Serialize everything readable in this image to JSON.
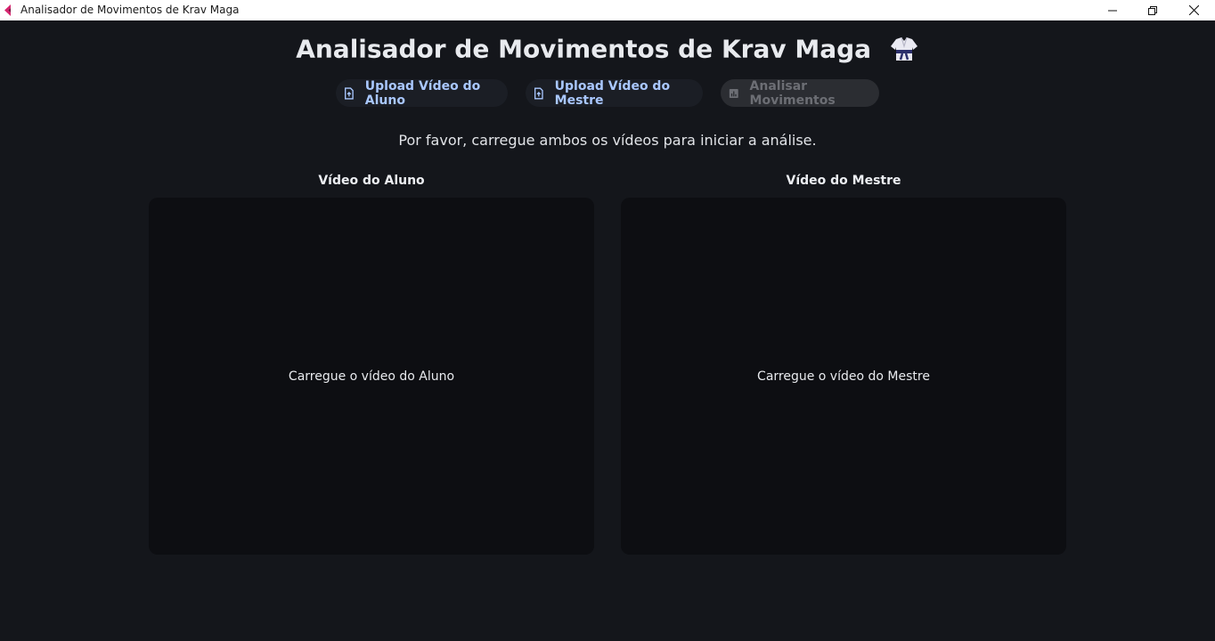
{
  "window": {
    "title": "Analisador de Movimentos de Krav Maga",
    "app_icon": "krav-maga-app-icon",
    "controls": [
      "minimize-icon",
      "restore-icon",
      "close-icon"
    ]
  },
  "header": {
    "title": "Analisador de Movimentos de Krav Maga",
    "title_icon": "martial-arts-uniform-icon"
  },
  "toolbar": {
    "upload_aluno_label": "Upload Vídeo do Aluno",
    "upload_aluno_icon": "file-upload-icon",
    "upload_mestre_label": "Upload Vídeo do Mestre",
    "upload_mestre_icon": "file-upload-icon",
    "analisar_label": "Analisar Movimentos",
    "analisar_icon": "bar-chart-icon",
    "analisar_enabled": false
  },
  "status_message": "Por favor, carregue ambos os vídeos para iniciar a análise.",
  "panes": {
    "aluno": {
      "label": "Vídeo do Aluno",
      "placeholder": "Carregue o vídeo do Aluno"
    },
    "mestre": {
      "label": "Vídeo do Mestre",
      "placeholder": "Carregue o vídeo do Mestre"
    }
  },
  "colors": {
    "background": "#14161b",
    "pane_background": "#0d0e12",
    "upload_button_bg": "#1b1e25",
    "upload_button_text": "#a9c7ff",
    "disabled_button_bg": "#2b2d32",
    "disabled_button_text": "#6c6e74",
    "app_icon_accent": "#d6246e"
  }
}
